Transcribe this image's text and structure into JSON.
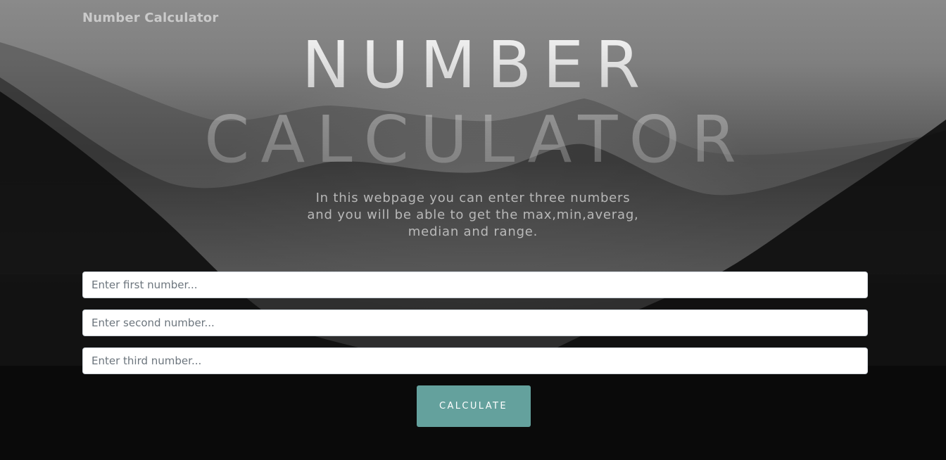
{
  "navbar": {
    "brand": "Number Calculator"
  },
  "hero": {
    "title_line1": "NUMBER",
    "title_line2": "CALCULATOR",
    "subtitle": "In this webpage you can enter three numbers and you will be able to get the max,min,averag, median and range."
  },
  "form": {
    "first_placeholder": "Enter first number...",
    "second_placeholder": "Enter second number...",
    "third_placeholder": "Enter third number...",
    "first_value": "",
    "second_value": "",
    "third_value": "",
    "submit_label": "CALCULATE"
  },
  "colors": {
    "accent": "#64a19d",
    "background_dark": "#0b0b0b",
    "background_fog": "#8a8a8a"
  }
}
